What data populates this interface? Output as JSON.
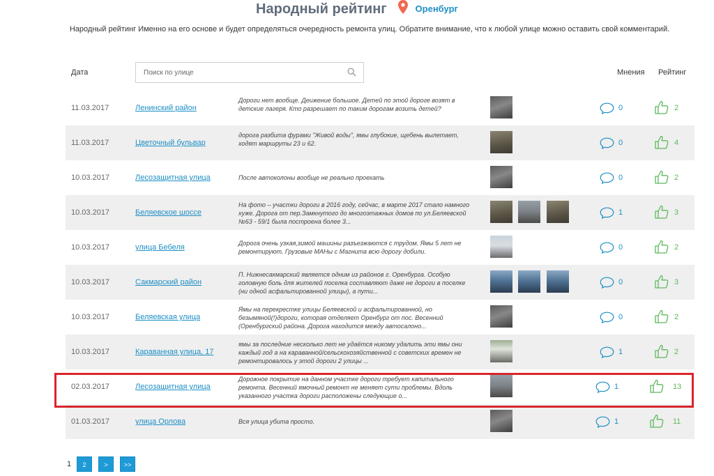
{
  "header": {
    "title": "Народный рейтинг",
    "city": "Оренбург",
    "intro": "Народный рейтинг Именно на его основе и будет определяться очередность ремонта улиц. Обратите внимание, что к любой улице можно оставить свой комментарий."
  },
  "table": {
    "col_date": "Дата",
    "search_placeholder": "Поиск по улице",
    "col_opinions": "Мнения",
    "col_rating": "Рейтинг",
    "rows": [
      {
        "date": "11.03.2017",
        "street": "Ленинский район",
        "comment": "Дороги нет вообще. Деижение большое. Детей по этой дороге возят в детские лагеря. Кто разрешает по таким дорогам возить детей?",
        "opinions": "0",
        "rating": "2"
      },
      {
        "date": "11.03.2017",
        "street": "Цветочный бульвар",
        "comment": "дорога разбита фурами \"Живой воды\", ямы глубокие, щебень вылетает, ходят маршруты 23 и 62.",
        "opinions": "0",
        "rating": "4"
      },
      {
        "date": "10.03.2017",
        "street": "Лесозащитная улица",
        "comment": "После автоколоны вообще не реально проехать",
        "opinions": "0",
        "rating": "2"
      },
      {
        "date": "10.03.2017",
        "street": "Беляевское шоссе",
        "comment": "На фото – участки дороги в 2016 году, сейчас, в марте 2017 стало намного хуже. Дорога от пер.Замкнутого до многоэтажных домов по ул.Беляевской №63 - 59/1 была построена более 3...",
        "opinions": "1",
        "rating": "3"
      },
      {
        "date": "10.03.2017",
        "street": "улица Бебеля",
        "comment": "Дорога очень узкая,зимой машины разъезжаются с трудом. Ямы 5 лет не ремонтируют. Грузовые МАНы с Магнита всю дорогу добили.",
        "opinions": "0",
        "rating": "2"
      },
      {
        "date": "10.03.2017",
        "street": "Сакмарский район",
        "comment": "П. Нижнесакмарский является одним из районов г. Оренбурга. Особую головную боль для жителей поселка составляют даже не дороги в поселке (ни одной асфальтированной улицы), а пути...",
        "opinions": "0",
        "rating": "3"
      },
      {
        "date": "10.03.2017",
        "street": "Беляевская улица",
        "comment": "Ямы на перекрестке улицы Беляевской и асфальтированной, но безымяной(!)дороги, которая отделяет Оренбург от пос. Весенний (Оренбургский района. Дорога находится между автосалоно...",
        "opinions": "0",
        "rating": "2"
      },
      {
        "date": "10.03.2017",
        "street": "Караванная улица, 17",
        "comment": "ямы за последние несколько лет не удаётся никому удалить эти ямы они каждый год а на караванной/сельскохозяйственной с советских времен не ремонтировалось у этой дороги 2 улицы ...",
        "opinions": "1",
        "rating": "2"
      },
      {
        "date": "02.03.2017",
        "street": "Лесозащитная улица",
        "comment": "Дорожное покрытие на данном участке дороги требует капитального ремонта. Весенний ямочный ремонт не меняет сути проблемы. Вдоль указанного участка дороги расположены следующие о...",
        "opinions": "1",
        "rating": "13"
      },
      {
        "date": "01.03.2017",
        "street": "улица Орлова",
        "comment": "Вся улица убита просто.",
        "opinions": "1",
        "rating": "11"
      }
    ]
  },
  "pagination": {
    "current": "1",
    "page2": "2",
    "next": ">",
    "last": ">>"
  },
  "colors": {
    "accent": "#1e8fc6",
    "like": "#5cb85c",
    "highlight": "#d9252b",
    "title": "#606c7a"
  }
}
